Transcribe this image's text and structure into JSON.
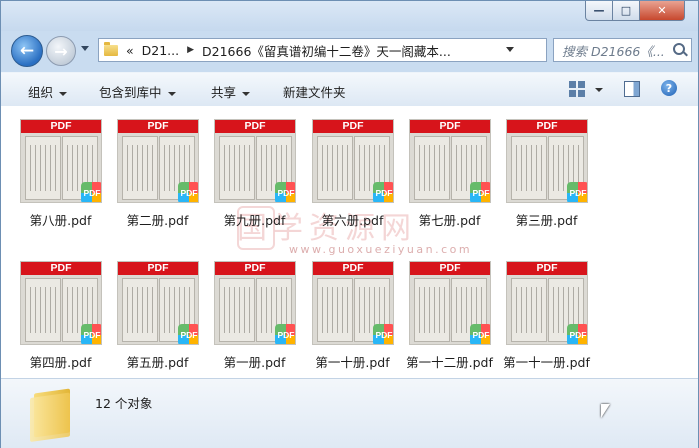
{
  "window": {
    "buttons": {
      "minimize": "—",
      "maximize": "□",
      "close": "✕"
    }
  },
  "nav": {
    "back_icon": "arrow-left-icon",
    "forward_icon": "arrow-right-icon",
    "address": {
      "prefix": "«",
      "crumb1": "D21...",
      "crumb2": "D21666《留真谱初编十二卷》天一阁藏本..."
    },
    "search_placeholder": "搜索 D21666《..."
  },
  "toolbar": {
    "organize": "组织",
    "include_in_library": "包含到库中",
    "share": "共享",
    "new_folder": "新建文件夹"
  },
  "files": [
    {
      "name": "第八册.pdf",
      "label": "PDF",
      "badge": "PDF"
    },
    {
      "name": "第二册.pdf",
      "label": "PDF",
      "badge": "PDF"
    },
    {
      "name": "第九册.pdf",
      "label": "PDF",
      "badge": "PDF"
    },
    {
      "name": "第六册.pdf",
      "label": "PDF",
      "badge": "PDF"
    },
    {
      "name": "第七册.pdf",
      "label": "PDF",
      "badge": "PDF"
    },
    {
      "name": "第三册.pdf",
      "label": "PDF",
      "badge": "PDF"
    },
    {
      "name": "第四册.pdf",
      "label": "PDF",
      "badge": "PDF"
    },
    {
      "name": "第五册.pdf",
      "label": "PDF",
      "badge": "PDF"
    },
    {
      "name": "第一册.pdf",
      "label": "PDF",
      "badge": "PDF"
    },
    {
      "name": "第一十册.pdf",
      "label": "PDF",
      "badge": "PDF"
    },
    {
      "name": "第一十二册.pdf",
      "label": "PDF",
      "badge": "PDF"
    },
    {
      "name": "第一十一册.pdf",
      "label": "PDF",
      "badge": "PDF"
    }
  ],
  "watermark": {
    "text": "国学资源网",
    "url": "www.guoxueziyuan.com"
  },
  "status": {
    "count": "12 个对象"
  },
  "colors": {
    "pdf_band": "#d7141b",
    "window_frame": "#c9dcf0"
  }
}
